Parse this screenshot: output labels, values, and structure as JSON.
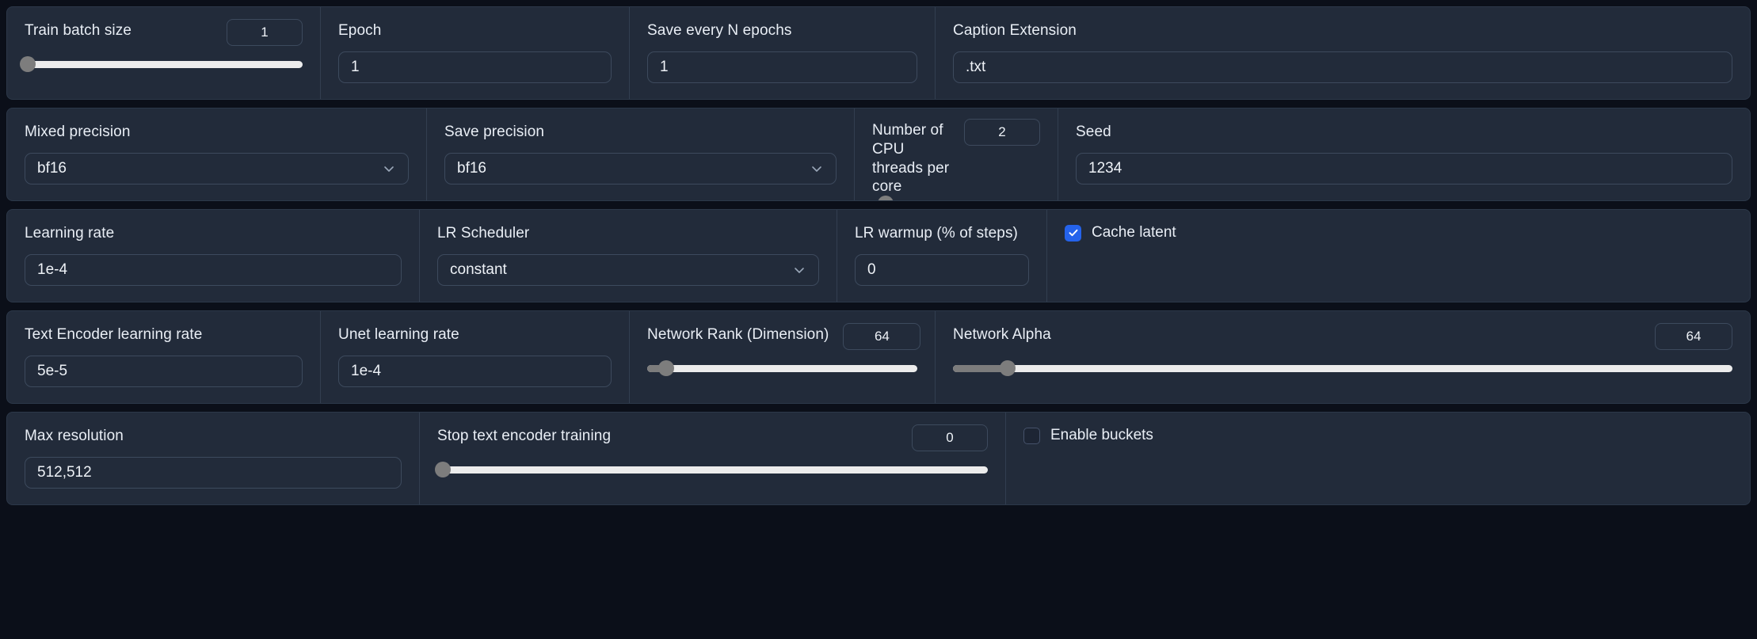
{
  "theme": {
    "panel_bg": "#222b3a",
    "page_bg": "#0b0f19",
    "border": "#3d4a5d",
    "accent": "#2563eb",
    "slider_track": "#ececec",
    "slider_thumb": "#7d7d7d",
    "text": "#e9eef5"
  },
  "rows": [
    {
      "name": "row-basic",
      "cells": [
        {
          "type": "slider",
          "name": "train-batch-size",
          "label": "Train batch size",
          "value": "1",
          "percent": 1
        },
        {
          "type": "text",
          "name": "epoch",
          "label": "Epoch",
          "value": "1"
        },
        {
          "type": "text",
          "name": "save-every-n-epochs",
          "label": "Save every N epochs",
          "value": "1"
        },
        {
          "type": "text",
          "name": "caption-extension",
          "label": "Caption Extension",
          "value": ".txt"
        }
      ]
    },
    {
      "name": "row-precision",
      "cells": [
        {
          "type": "dropdown",
          "name": "mixed-precision",
          "label": "Mixed precision",
          "value": "bf16"
        },
        {
          "type": "dropdown",
          "name": "save-precision",
          "label": "Save precision",
          "value": "bf16"
        },
        {
          "type": "slider",
          "name": "cpu-threads-per-core",
          "label": "Number of CPU threads per core",
          "value": "2",
          "percent": 8
        },
        {
          "type": "text",
          "name": "seed",
          "label": "Seed",
          "value": "1234"
        }
      ]
    },
    {
      "name": "row-learning",
      "cells": [
        {
          "type": "text",
          "name": "learning-rate",
          "label": "Learning rate",
          "value": "1e-4"
        },
        {
          "type": "dropdown",
          "name": "lr-scheduler",
          "label": "LR Scheduler",
          "value": "constant"
        },
        {
          "type": "text",
          "name": "lr-warmup",
          "label": "LR warmup (% of steps)",
          "value": "0"
        },
        {
          "type": "checkbox",
          "name": "cache-latent",
          "label": "Cache latent",
          "checked": true
        }
      ]
    },
    {
      "name": "row-network",
      "cells": [
        {
          "type": "text",
          "name": "text-encoder-learning-rate",
          "label": "Text Encoder learning rate",
          "value": "5e-5"
        },
        {
          "type": "text",
          "name": "unet-learning-rate",
          "label": "Unet learning rate",
          "value": "1e-4"
        },
        {
          "type": "slider",
          "name": "network-rank-dimension",
          "label": "Network Rank (Dimension)",
          "value": "64",
          "percent": 7
        },
        {
          "type": "slider",
          "name": "network-alpha",
          "label": "Network Alpha",
          "value": "64",
          "percent": 7
        }
      ]
    },
    {
      "name": "row-resolution",
      "cells": [
        {
          "type": "text",
          "name": "max-resolution",
          "label": "Max resolution",
          "value": "512,512"
        },
        {
          "type": "slider",
          "name": "stop-text-encoder-training",
          "label": "Stop text encoder training",
          "value": "0",
          "percent": 0
        },
        {
          "type": "checkbox",
          "name": "enable-buckets",
          "label": "Enable buckets",
          "checked": false
        }
      ]
    }
  ]
}
